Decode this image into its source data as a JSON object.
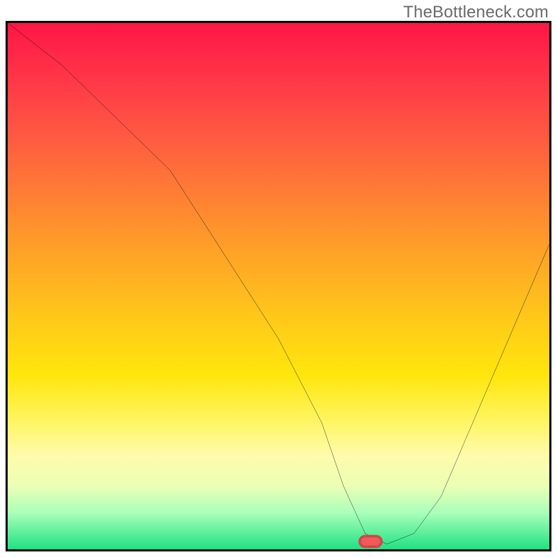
{
  "watermark": "TheBottleneck.com",
  "chart_data": {
    "type": "line",
    "title": "",
    "xlabel": "",
    "ylabel": "",
    "xlim": [
      0,
      100
    ],
    "ylim": [
      0,
      100
    ],
    "annotations": [
      {
        "type": "marker",
        "shape": "pill",
        "x": 67,
        "y": 1.5,
        "color": "#f25a5a"
      }
    ],
    "series": [
      {
        "name": "curve",
        "x": [
          0,
          10,
          20,
          30,
          40,
          50,
          58,
          62,
          66,
          70,
          75,
          80,
          85,
          90,
          95,
          100
        ],
        "y": [
          100,
          92,
          82,
          72,
          56,
          40,
          24,
          12,
          3,
          1,
          3,
          10,
          22,
          34,
          46,
          58
        ]
      }
    ],
    "grid": false,
    "legend": false
  }
}
